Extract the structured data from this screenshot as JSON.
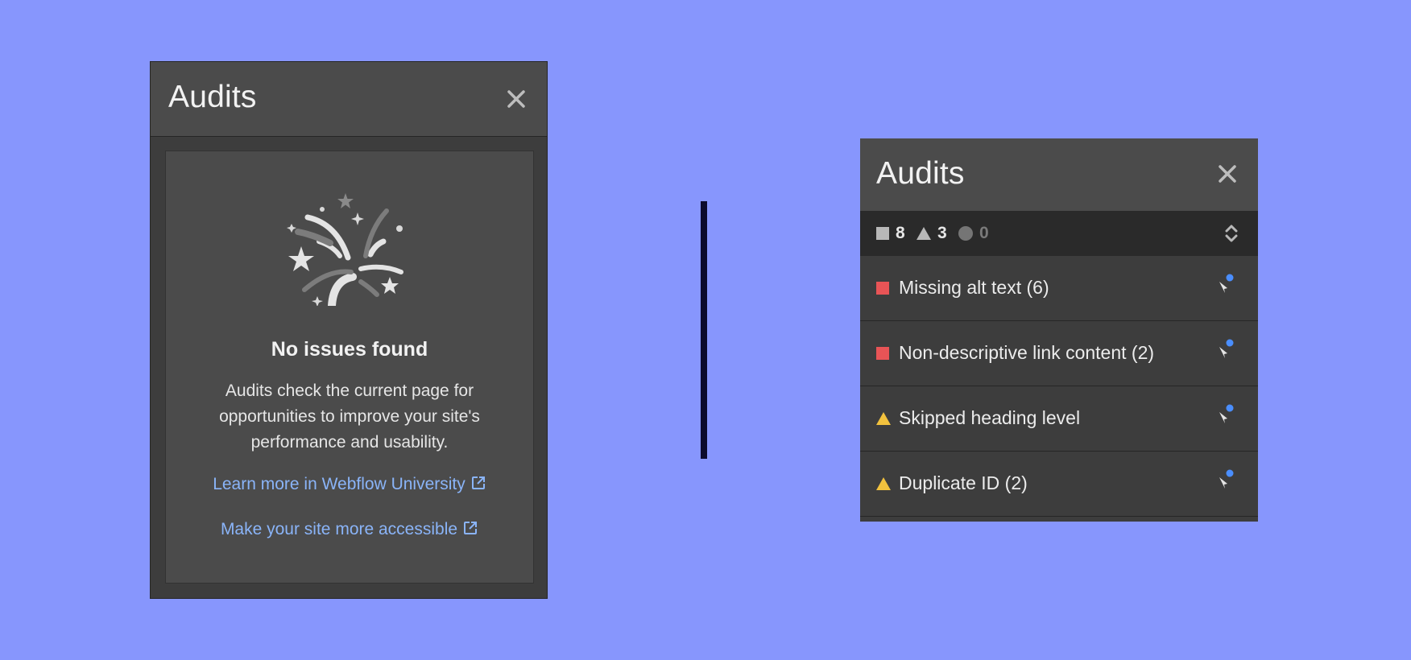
{
  "left_panel": {
    "title": "Audits",
    "empty_state": {
      "heading": "No issues found",
      "description": "Audits check the current page for opportunities to improve your site's performance and usability.",
      "links": [
        {
          "label": "Learn more in Webflow University",
          "icon": "external-link-icon"
        },
        {
          "label": "Make your site more accessible",
          "icon": "external-link-icon"
        }
      ]
    }
  },
  "right_panel": {
    "title": "Audits",
    "summary": {
      "errors": "8",
      "warnings": "3",
      "suggestions": "0"
    },
    "issues": [
      {
        "severity": "error",
        "label": "Missing alt text (6)"
      },
      {
        "severity": "error",
        "label": "Non-descriptive link content (2)"
      },
      {
        "severity": "warning",
        "label": "Skipped heading level"
      },
      {
        "severity": "warning",
        "label": "Duplicate ID (2)"
      }
    ]
  },
  "colors": {
    "background": "#8796fd",
    "panel": "#3d3d3d",
    "header": "#4b4b4b",
    "error": "#e85456",
    "warning": "#f2c23e",
    "link": "#8ab4f8",
    "dot": "#4a8eff",
    "divider": "#0c0b2c"
  }
}
